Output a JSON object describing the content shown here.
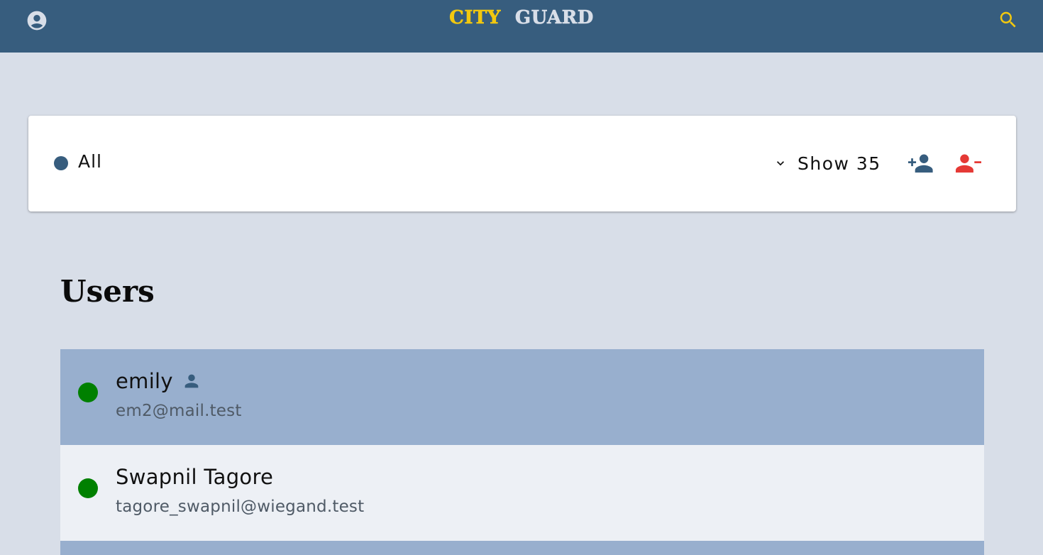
{
  "header": {
    "brand_part1": "CITY",
    "brand_part2": "GUARD",
    "account_icon": "account-circle-icon",
    "search_icon": "search-icon",
    "colors": {
      "bar": "#375d7e",
      "brand_accent": "#f2c80f",
      "brand_secondary": "#d8dee8"
    }
  },
  "filter": {
    "status_label": "All",
    "status_color": "#375d7e",
    "show_label": "Show 35",
    "add_user_icon": "person-add-icon",
    "remove_user_icon": "person-remove-icon",
    "remove_color": "#e53935"
  },
  "users": {
    "title": "Users",
    "items": [
      {
        "name": "emily",
        "email": "em2@mail.test",
        "status_color": "#008000",
        "has_person_badge": true
      },
      {
        "name": "Swapnil Tagore",
        "email": "tagore_swapnil@wiegand.test",
        "status_color": "#008000",
        "has_person_badge": false
      }
    ]
  }
}
